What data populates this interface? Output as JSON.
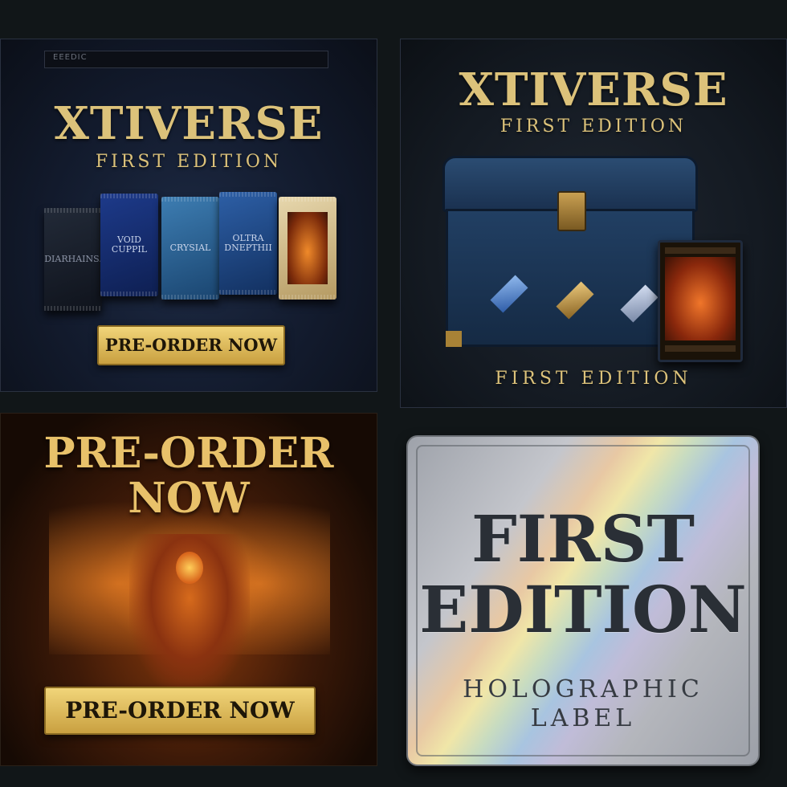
{
  "panel1": {
    "topbar_text": "EEEDIC",
    "title": "XTIVERSE",
    "subtitle": "FIRST EDITION",
    "packs": [
      {
        "label": "DIARHAINS."
      },
      {
        "label": "VOID CUPPIL"
      },
      {
        "label": "CRYSIAL"
      },
      {
        "label": "OLTRA DNEPTHII"
      },
      {
        "label": ""
      }
    ],
    "button": "PRE-ORDER NOW"
  },
  "panel2": {
    "title": "XTIVERSE",
    "subtitle": "FIRST EDITION",
    "footer": "FIRST EDITION"
  },
  "panel3": {
    "title_line1": "PRE-ORDER",
    "title_line2": "NOW",
    "button": "PRE-ORDER NOW"
  },
  "panel4": {
    "big_line1": "FIRST",
    "big_line2": "EDITION",
    "sub_line1": "HOLOGRAPHIC",
    "sub_line2": "LABEL"
  },
  "colors": {
    "gold": "#dcc27a",
    "button_gold": "#e0bb58",
    "background": "#111618"
  }
}
